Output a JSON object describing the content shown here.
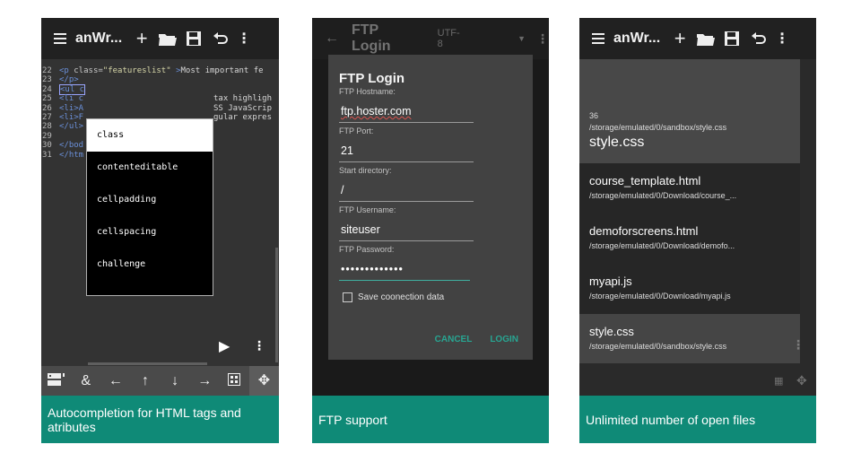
{
  "panel1": {
    "toolbar": {
      "title": "anWr..."
    },
    "code_lines": [
      {
        "num": "22",
        "html": "<p class=\"featureslist\" >Most important fe"
      },
      {
        "num": "23",
        "text": "</p>"
      },
      {
        "num": "24",
        "text": "<ul c"
      },
      {
        "num": "25",
        "text": "<li c"
      },
      {
        "num": "26",
        "text": "<li>A"
      },
      {
        "num": "27",
        "text": "<li>F"
      },
      {
        "num": "28",
        "text": "</ul>"
      },
      {
        "num": "29",
        "text": ""
      },
      {
        "num": "30",
        "text": "</bod"
      },
      {
        "num": "31",
        "text": "</htm"
      }
    ],
    "code_right_fragments": [
      "tax highligh",
      "SS JavaScrip",
      "gular expres"
    ],
    "autocomplete": [
      "class",
      "contenteditable",
      "cellpadding",
      "cellspacing",
      "challenge"
    ],
    "keybar": {
      "ampersand": "&"
    },
    "caption": "Autocompletion for HTML tags and atributes"
  },
  "panel2": {
    "toolbar": {
      "title": "FTP Login",
      "encoding": "UTF-8"
    },
    "dialog": {
      "title": "FTP Login",
      "hostname_label": "FTP Hostname:",
      "hostname_value": "ftp.hoster.com",
      "port_label": "FTP Port:",
      "port_value": "21",
      "dir_label": "Start directory:",
      "dir_value": "/",
      "user_label": "FTP Username:",
      "user_value": "siteuser",
      "pass_label": "FTP Password:",
      "pass_value": "•••••••••••••",
      "save_label": "Save coonection data",
      "cancel": "CANCEL",
      "login": "LOGIN"
    },
    "caption": "FTP support"
  },
  "panel3": {
    "toolbar": {
      "title": "anWr..."
    },
    "files": [
      {
        "num": "36",
        "path": "/storage/emulated/0/sandbox/style.css",
        "name": "style.css"
      },
      {
        "name": "course_template.html",
        "path": "/storage/emulated/0/Download/course_..."
      },
      {
        "name": "demoforscreens.html",
        "path": "/storage/emulated/0/Download/demofo..."
      },
      {
        "name": "myapi.js",
        "path": "/storage/emulated/0/Download/myapi.js"
      },
      {
        "name": "style.css",
        "path": "/storage/emulated/0/sandbox/style.css"
      }
    ],
    "caption": "Unlimited number of open files"
  }
}
